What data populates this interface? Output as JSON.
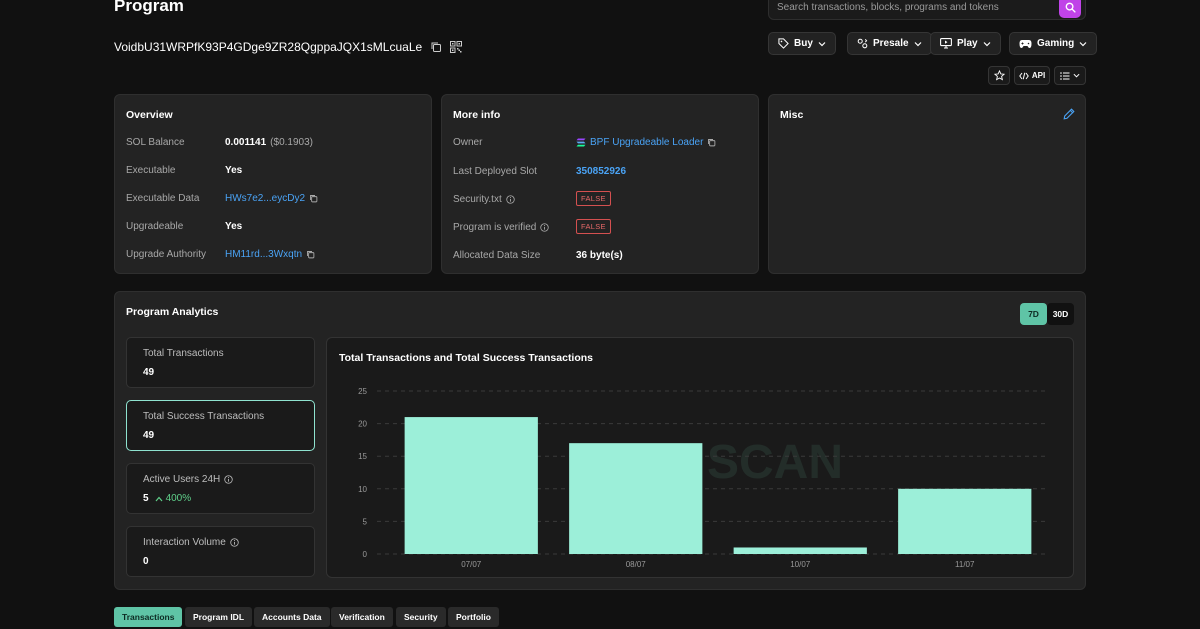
{
  "header": {
    "title": "Program",
    "search_placeholder": "Search transactions, blocks, programs and tokens",
    "address": "VoidbU31WRPfK93P4GDge9ZR28QgppaJQX1sMLcuaLe"
  },
  "nav": {
    "buy": "Buy",
    "presale": "Presale",
    "play": "Play",
    "gaming": "Gaming",
    "api": "API"
  },
  "overview": {
    "title": "Overview",
    "sol_balance_label": "SOL Balance",
    "sol_balance_value": "0.001141",
    "sol_balance_usd": "($0.1903)",
    "executable_label": "Executable",
    "executable_value": "Yes",
    "executable_data_label": "Executable Data",
    "executable_data_value": "HWs7e2...eycDy2",
    "upgradeable_label": "Upgradeable",
    "upgradeable_value": "Yes",
    "upgrade_authority_label": "Upgrade Authority",
    "upgrade_authority_value": "HM11rd...3Wxqtn"
  },
  "more_info": {
    "title": "More info",
    "owner_label": "Owner",
    "owner_value": "BPF Upgradeable Loader",
    "last_slot_label": "Last Deployed Slot",
    "last_slot_value": "350852926",
    "security_label": "Security.txt",
    "security_value": "FALSE",
    "verified_label": "Program is verified",
    "verified_value": "FALSE",
    "data_size_label": "Allocated Data Size",
    "data_size_value": "36 byte(s)"
  },
  "misc": {
    "title": "Misc"
  },
  "analytics": {
    "title": "Program Analytics",
    "range_7d": "7D",
    "range_30d": "30D",
    "total_tx_label": "Total Transactions",
    "total_tx_value": "49",
    "success_tx_label": "Total Success Transactions",
    "success_tx_value": "49",
    "active_users_label": "Active Users 24H",
    "active_users_value": "5",
    "active_users_change": "400%",
    "interaction_label": "Interaction Volume",
    "interaction_value": "0",
    "watermark": "SCAN"
  },
  "chart_data": {
    "type": "bar",
    "title": "Total Transactions and Total Success Transactions",
    "categories": [
      "07/07",
      "08/07",
      "10/07",
      "11/07"
    ],
    "values": [
      21,
      17,
      1,
      10
    ],
    "yticks": [
      0,
      5,
      10,
      15,
      20,
      25
    ],
    "ylim": [
      0,
      25
    ],
    "grid": true,
    "bar_color": "#9cefd9"
  },
  "tabs": [
    "Transactions",
    "Program IDL",
    "Accounts Data",
    "Verification",
    "Security",
    "Portfolio"
  ],
  "colors": {
    "accent": "#5fc4a6",
    "link": "#4aa3f5",
    "search": "#c043e8",
    "danger": "#e56868"
  }
}
